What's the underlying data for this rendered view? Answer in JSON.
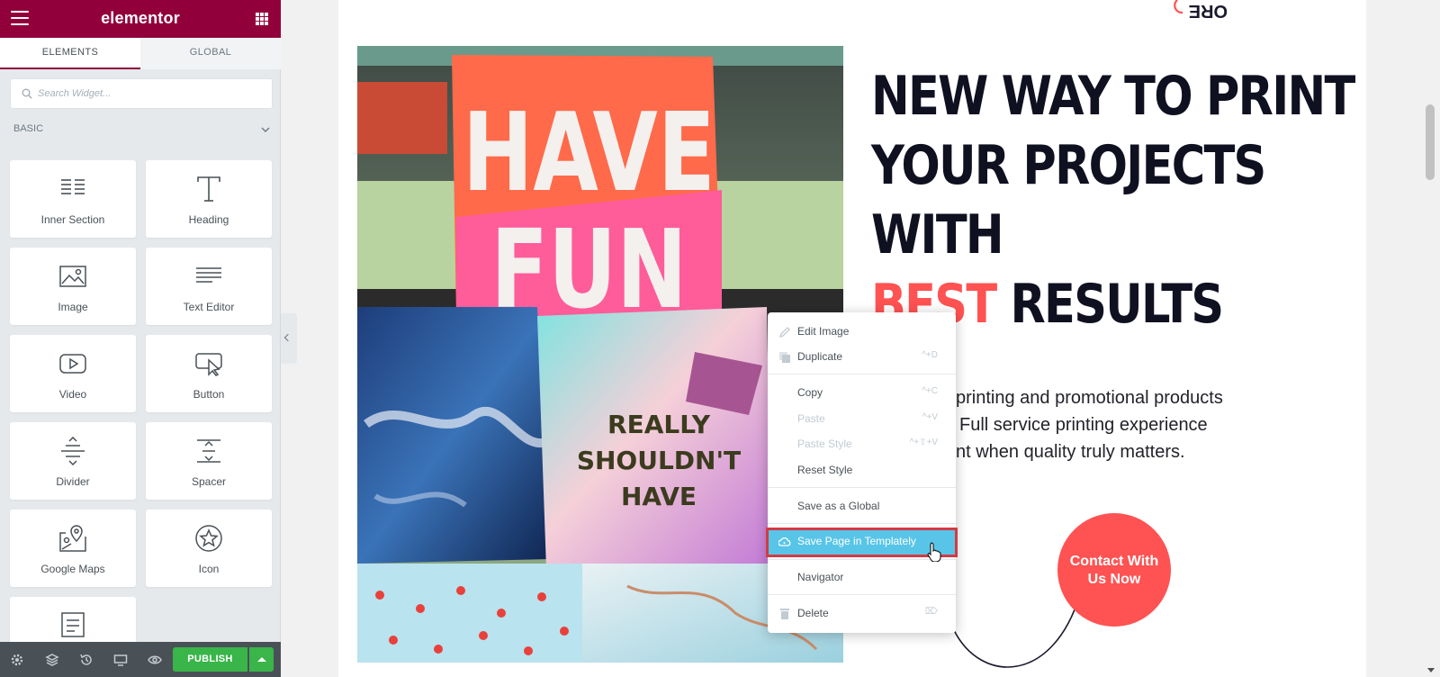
{
  "app": {
    "logo": "elementor"
  },
  "panel": {
    "tabs": [
      {
        "label": "ELEMENTS"
      },
      {
        "label": "GLOBAL"
      }
    ],
    "search": {
      "placeholder": "Search Widget..."
    },
    "category": "BASIC",
    "widgets": [
      {
        "label": "Inner Section",
        "icon": "inner-section-icon"
      },
      {
        "label": "Heading",
        "icon": "heading-icon"
      },
      {
        "label": "Image",
        "icon": "image-icon"
      },
      {
        "label": "Text Editor",
        "icon": "text-editor-icon"
      },
      {
        "label": "Video",
        "icon": "video-icon"
      },
      {
        "label": "Button",
        "icon": "button-icon"
      },
      {
        "label": "Divider",
        "icon": "divider-icon"
      },
      {
        "label": "Spacer",
        "icon": "spacer-icon"
      },
      {
        "label": "Google Maps",
        "icon": "google-maps-icon"
      },
      {
        "label": "Icon",
        "icon": "star-icon"
      },
      {
        "label": "",
        "icon": "text-path-icon"
      }
    ],
    "footer": {
      "publish_label": "PUBLISH"
    }
  },
  "canvas": {
    "badge_text": "ORE",
    "headline": {
      "line1": "NEW WAY TO PRINT",
      "line2": "YOUR PROJECTS",
      "line3": "WITH",
      "line4_accent": "BEST",
      "line4_rest": "RESULTS"
    },
    "paragraph": {
      "line1": "printing and promotional products",
      "line2": "Full service printing experience",
      "line3": "nt when quality truly matters."
    },
    "contact_button": {
      "line1": "Contact With",
      "line2": "Us Now"
    },
    "image_text": {
      "bag1_line1": "HAVE",
      "bag1_line2": "FUN",
      "bag2_line1": "REALLY",
      "bag2_line2": "SHOULDN'T",
      "bag2_line3": "HAVE"
    }
  },
  "context_menu": {
    "items": [
      {
        "label": "Edit Image",
        "shortcut": "",
        "icon": "pencil-icon"
      },
      {
        "label": "Duplicate",
        "shortcut": "^+D",
        "icon": "duplicate-icon"
      },
      {
        "label": "Copy",
        "shortcut": "^+C"
      },
      {
        "label": "Paste",
        "shortcut": "^+V"
      },
      {
        "label": "Paste Style",
        "shortcut": "^+⇧+V"
      },
      {
        "label": "Reset Style",
        "shortcut": ""
      },
      {
        "label": "Save as a Global",
        "shortcut": ""
      },
      {
        "label": "Save Page in Templately",
        "shortcut": "",
        "icon": "cloud-icon"
      },
      {
        "label": "Navigator",
        "shortcut": ""
      },
      {
        "label": "Delete",
        "shortcut": "⌦",
        "icon": "trash-icon"
      }
    ]
  },
  "colors": {
    "brand": "#92003b",
    "accent": "#ff5252",
    "publish": "#39b54a",
    "menu_highlight": "#58c5e8",
    "highlight_outline": "#d43a44"
  }
}
